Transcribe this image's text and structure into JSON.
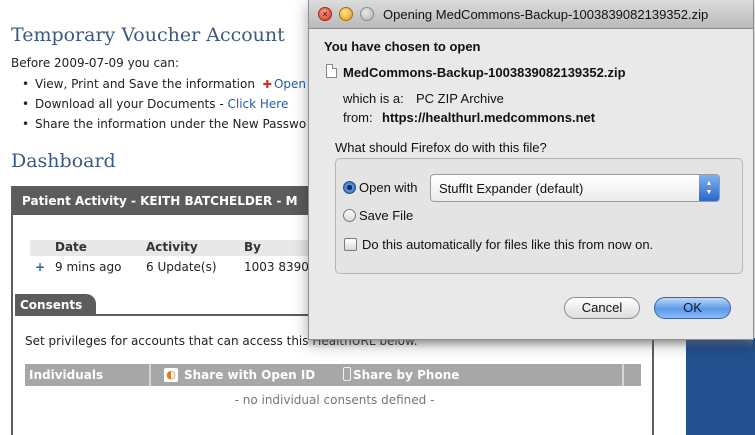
{
  "page": {
    "title": "Temporary Voucher Account",
    "intro": "Before 2009-07-09 you can:",
    "bullets": [
      {
        "text": "View, Print and Save the information ",
        "link": "Open"
      },
      {
        "text": "Download all your Documents - ",
        "link": "Click Here"
      },
      {
        "text": "Share the information under the New Passwo",
        "link": ""
      }
    ],
    "dashboard_title": "Dashboard",
    "activity": {
      "header": "Patient Activity - KEITH BATCHELDER - M",
      "columns": [
        "Date",
        "Activity",
        "By"
      ],
      "rows": [
        {
          "toggle": "+",
          "date": "9 mins ago",
          "activity": "6 Update(s)",
          "by": "1003 8390"
        }
      ]
    },
    "consents": {
      "tab": "Consents",
      "text": "Set privileges for accounts that can access this HealthURL below.",
      "columns": [
        "Individuals",
        "Share with Open ID",
        "Share by Phone"
      ],
      "empty": "- no individual consents defined -"
    }
  },
  "dialog": {
    "title": "Opening MedCommons-Backup-1003839082139352.zip",
    "chosen": "You have chosen to open",
    "filename": "MedCommons-Backup-1003839082139352.zip",
    "which_label": "which is a:",
    "which_value": "PC ZIP Archive",
    "from_label": "from:",
    "from_value": "https://healthurl.medcommons.net",
    "question": "What should Firefox do with this file?",
    "open_with_label": "Open with",
    "open_with_value": "StuffIt Expander (default)",
    "save_label": "Save File",
    "auto_label": "Do this automatically for files like this from now on.",
    "cancel": "Cancel",
    "ok": "OK",
    "selected_option": "open_with",
    "auto_checked": false
  },
  "colors": {
    "heading": "#3b5a7e",
    "link": "#1f5fb0",
    "panel_header": "#5c5c5c",
    "accent_blue": "#23508f"
  },
  "icons": [
    "red-cross-icon",
    "file-icon",
    "open-id-icon",
    "phone-icon",
    "select-arrows-icon"
  ]
}
